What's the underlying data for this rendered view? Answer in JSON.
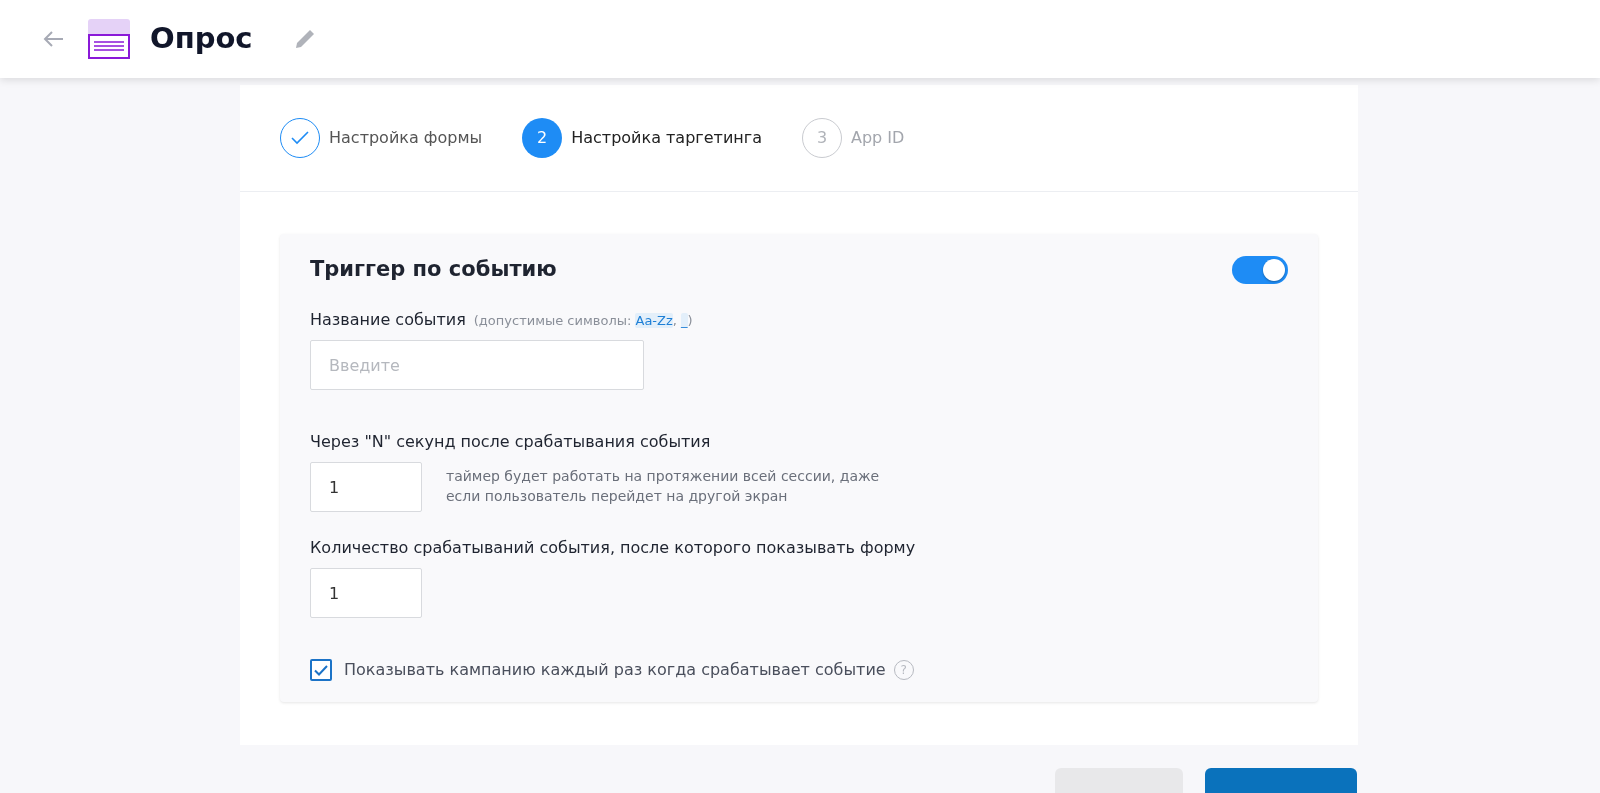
{
  "header": {
    "title": "Опрос"
  },
  "steps": [
    {
      "label": "Настройка формы",
      "done": true,
      "selected": false
    },
    {
      "number": "2",
      "label": "Настройка таргетинга",
      "done": false,
      "selected": true
    },
    {
      "number": "3",
      "label": "App ID",
      "done": false,
      "selected": false
    }
  ],
  "panel": {
    "title": "Триггер по событию",
    "enabled": true,
    "event_name": {
      "label": "Название события",
      "hint": [
        {
          "kind": "plain",
          "text": "(допустимые символы: "
        },
        {
          "kind": "code",
          "text": "Aa-Zz"
        },
        {
          "kind": "plain",
          "text": ", "
        },
        {
          "kind": "code",
          "text": "_"
        },
        {
          "kind": "plain",
          "text": ")"
        }
      ],
      "placeholder": "Введите"
    },
    "delay": {
      "label": "Через \"N\" секунд после срабатывания события",
      "value": "1",
      "note": "таймер будет работать на протяжении всей сессии, даже если пользователь перейдет на другой экран"
    },
    "count": {
      "label": "Количество срабатываний события, после которого показывать форму",
      "value": "1"
    },
    "every_time": {
      "label": "Показывать кампанию каждый раз когда срабатывает событие",
      "checked": true,
      "help": "?"
    }
  },
  "footer_buttons": [
    {
      "kind": "secondary"
    },
    {
      "kind": "primary"
    }
  ]
}
